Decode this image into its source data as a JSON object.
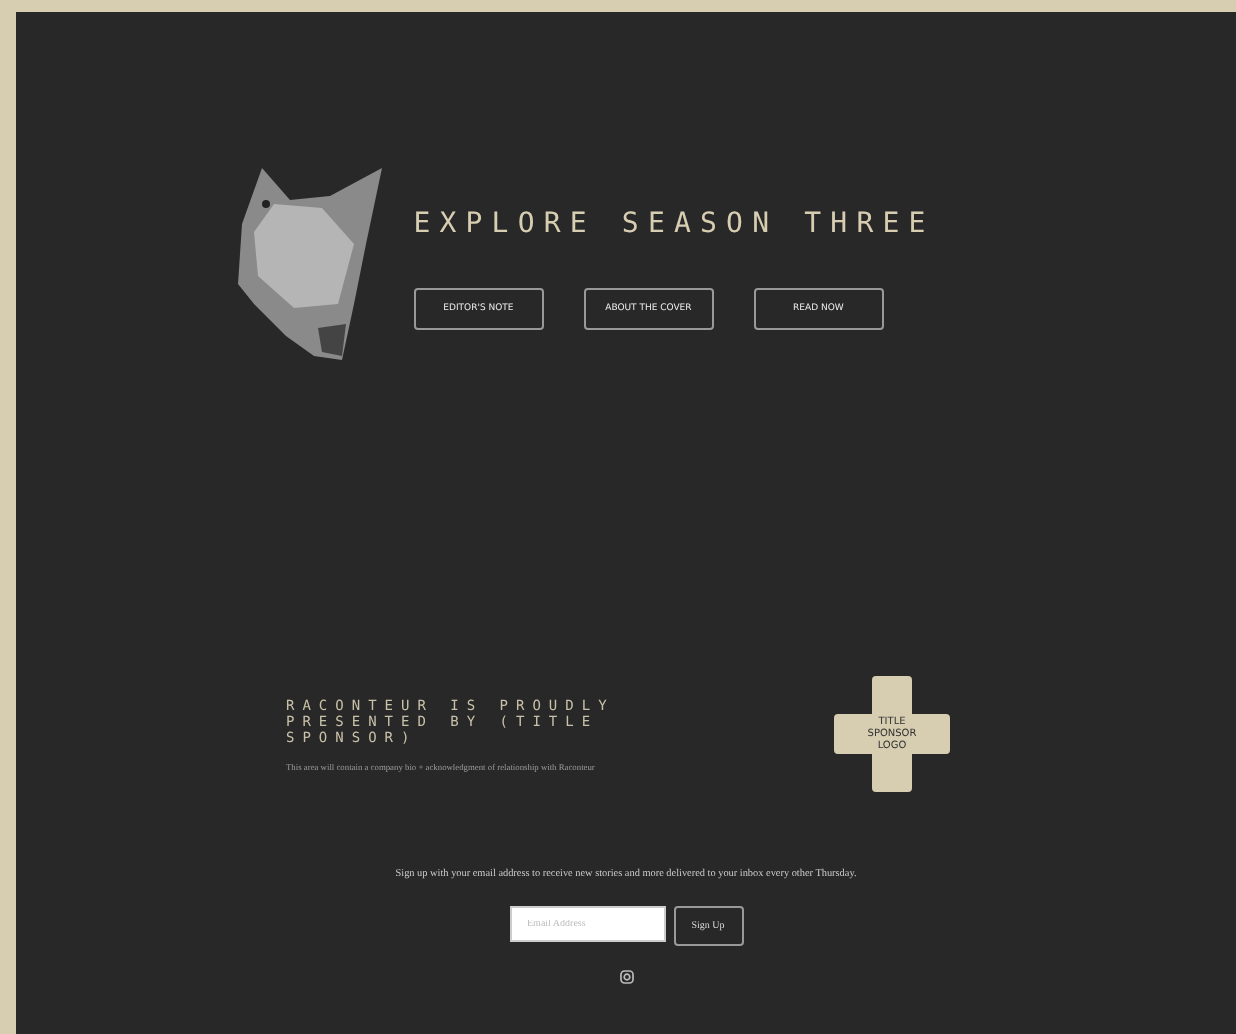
{
  "hero": {
    "title": "EXPLORE SEASON THREE",
    "buttons": [
      "EDITOR'S NOTE",
      "ABOUT THE COVER",
      "READ NOW"
    ]
  },
  "sponsor": {
    "heading": "RACONTEUR IS PROUDLY PRESENTED BY (TITLE SPONSOR)",
    "description": "This area will contain a company bio + acknowledgment of relationship with Raconteur",
    "logo": "TITLE SPONSOR LOGO"
  },
  "signup": {
    "text": "Sign up with your email address to receive new stories and more delivered to your inbox every other Thursday.",
    "email": {
      "placeholder": "Email Address"
    },
    "button": "Sign Up"
  }
}
